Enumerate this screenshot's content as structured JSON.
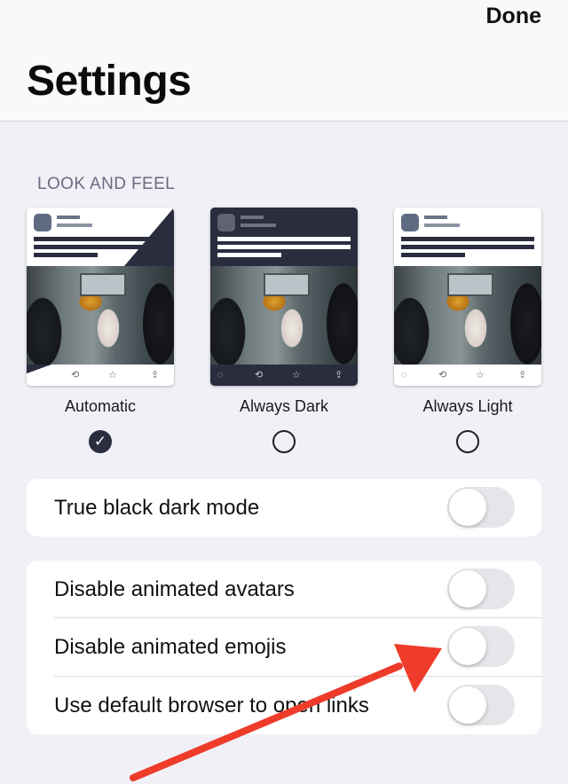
{
  "header": {
    "done_label": "Done",
    "title": "Settings"
  },
  "look_and_feel": {
    "section_label": "LOOK AND FEEL",
    "themes": [
      {
        "label": "Automatic",
        "selected": true
      },
      {
        "label": "Always Dark",
        "selected": false
      },
      {
        "label": "Always Light",
        "selected": false
      }
    ]
  },
  "groups": [
    {
      "rows": [
        {
          "label": "True black dark mode",
          "on": false
        }
      ]
    },
    {
      "rows": [
        {
          "label": "Disable animated avatars",
          "on": false
        },
        {
          "label": "Disable animated emojis",
          "on": false
        },
        {
          "label": "Use default browser to open links",
          "on": false
        }
      ]
    }
  ],
  "colors": {
    "annotation_arrow": "#ee3b2a",
    "selected_radio": "#2a2d3e",
    "dark_card": "#2a2d3e"
  }
}
